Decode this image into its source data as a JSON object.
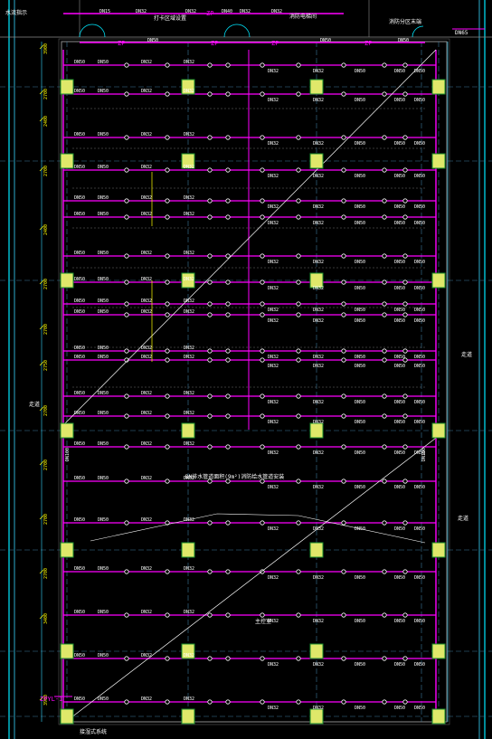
{
  "labels": {
    "pipe_dn15": "DN15",
    "pipe_dn32": "DN32",
    "pipe_dn40": "DN40",
    "pipe_dn50": "DN50",
    "pipe_dn65": "DN65",
    "pipe_dn100": "DN100",
    "zp": "ZP",
    "riser_tag": "ZPYL-1",
    "dims_left": [
      "3900",
      "2700",
      "2400",
      "2700",
      "2400",
      "2700",
      "2700",
      "2750",
      "2700",
      "2700",
      "2700",
      "2700",
      "3400"
    ],
    "notes_top": [
      "水流指示",
      "打卡区域设置",
      "消防电梯间",
      "消防分区末端"
    ],
    "note_mid": "DN排水管道面积(9m²)消防给水管道安装",
    "note_right_a": "走道",
    "note_right_b": "走道",
    "note_left": "走道",
    "valve_note": "主控室",
    "bottom_note": "接湿式系统"
  },
  "colors": {
    "background": "#000000",
    "main_pipe": "#ff00ff",
    "branch_line": "#ffffff",
    "column": "#dfe86a",
    "column_border": "#1a8f2e",
    "wall": "#00e8ff",
    "dimension": "#ffff00",
    "annotation_green": "#00ff00",
    "cyan_line": "#37d6ff"
  }
}
